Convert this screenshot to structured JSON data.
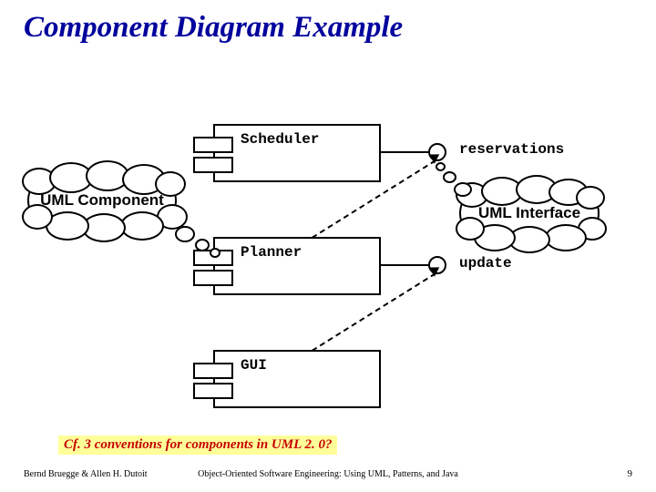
{
  "title": "Component Diagram Example",
  "components": {
    "scheduler": {
      "label": "Scheduler",
      "interface": "reservations"
    },
    "planner": {
      "label": "Planner",
      "interface": "update"
    },
    "gui": {
      "label": "GUI"
    }
  },
  "callouts": {
    "component": "UML Component",
    "interface": "UML Interface"
  },
  "note": "Cf. 3 conventions for components in UML 2. 0?",
  "footer": {
    "left": "Bernd Bruegge & Allen H. Dutoit",
    "center": "Object-Oriented Software Engineering: Using UML, Patterns, and Java",
    "page": "9"
  },
  "chart_data": {
    "type": "diagram",
    "notation": "UML 1.x component diagram",
    "components": [
      {
        "name": "Scheduler",
        "provides": [
          "reservations"
        ]
      },
      {
        "name": "Planner",
        "provides": [
          "update"
        ],
        "depends_on": [
          "reservations"
        ]
      },
      {
        "name": "GUI",
        "depends_on": [
          "update"
        ]
      }
    ],
    "annotations": [
      {
        "text": "UML Component",
        "points_to": "Scheduler/Planner lug notation"
      },
      {
        "text": "UML Interface",
        "points_to": "reservations lollipop"
      }
    ],
    "note": "Cf. 3 conventions for components in UML 2.0?"
  }
}
